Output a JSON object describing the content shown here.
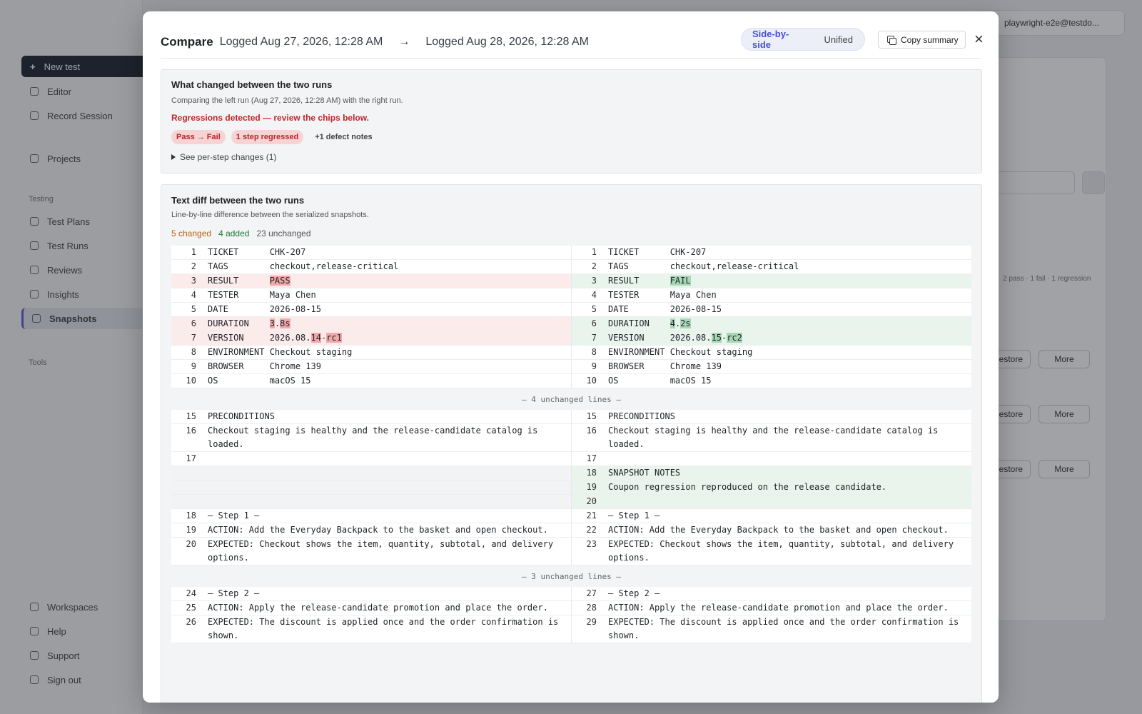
{
  "background": {
    "sidebar": {
      "primary": "New test",
      "items": [
        "Editor",
        "Record Session",
        "Projects"
      ],
      "section_testing": "Testing",
      "testing_items": [
        "Test Plans",
        "Test Runs",
        "Reviews",
        "Insights",
        "Snapshots"
      ],
      "section_tools": "Tools",
      "footer_items": [
        "Workspaces",
        "Help",
        "Support",
        "Sign out"
      ]
    },
    "account": "playwright-e2e@testdo...",
    "stats": "2 pass · 1 fail · 1 regression",
    "more_label": "More",
    "restore_label": "Restore"
  },
  "modal": {
    "title": "Compare",
    "left_run": "Logged Aug 27, 2026, 12:28 AM",
    "arrow": "→",
    "right_run": "Logged Aug 28, 2026, 12:28 AM",
    "view_options": [
      "Side-by-side",
      "Unified"
    ],
    "selected_view": "Side-by-side",
    "copy_label": "Copy summary",
    "close": "×"
  },
  "summary": {
    "title": "What changed between the two runs",
    "subtitle": "Comparing the left run (Aug 27, 2026, 12:28 AM) with the right run.",
    "warning": "Regressions detected — review the chips below.",
    "chips": [
      "Pass → Fail",
      "1 step regressed"
    ],
    "note": "+1 defect notes",
    "details": "See per-step changes (1)"
  },
  "diff": {
    "title": "Text diff between the two runs",
    "subtitle": "Line-by-line difference between the serialized snapshots.",
    "stats": {
      "changed": "5 changed",
      "added": "4 added",
      "unchanged": "23 unchanged"
    },
    "separator1": "— 4 unchanged lines —",
    "separator2": "— 3 unchanged lines —",
    "rows1": [
      {
        "l": {
          "n": "1",
          "t": "TICKET      CHK-207"
        },
        "r": {
          "n": "1",
          "t": "TICKET      CHK-207"
        }
      },
      {
        "l": {
          "n": "2",
          "t": "TAGS        checkout,release-critical"
        },
        "r": {
          "n": "2",
          "t": "TAGS        checkout,release-critical"
        }
      },
      {
        "type": "chg",
        "l": {
          "n": "3",
          "parts": [
            "RESULT      ",
            {
              "h": "PASS"
            }
          ]
        },
        "r": {
          "n": "3",
          "parts": [
            "RESULT      ",
            {
              "h": "FAIL"
            }
          ]
        }
      },
      {
        "l": {
          "n": "4",
          "t": "TESTER      Maya Chen"
        },
        "r": {
          "n": "4",
          "t": "TESTER      Maya Chen"
        }
      },
      {
        "l": {
          "n": "5",
          "t": "DATE        2026-08-15"
        },
        "r": {
          "n": "5",
          "t": "DATE        2026-08-15"
        }
      },
      {
        "type": "chg",
        "l": {
          "n": "6",
          "parts": [
            "DURATION    ",
            {
              "h": "3"
            },
            ".",
            {
              "h": "8s"
            }
          ]
        },
        "r": {
          "n": "6",
          "parts": [
            "DURATION    ",
            {
              "h": "4"
            },
            ".",
            {
              "h": "2s"
            }
          ]
        }
      },
      {
        "type": "chg",
        "l": {
          "n": "7",
          "parts": [
            "VERSION     2026.08.",
            {
              "h": "14"
            },
            "-",
            {
              "h": "rc1"
            }
          ]
        },
        "r": {
          "n": "7",
          "parts": [
            "VERSION     2026.08.",
            {
              "h": "15"
            },
            "-",
            {
              "h": "rc2"
            }
          ]
        }
      },
      {
        "l": {
          "n": "8",
          "t": "ENVIRONMENT Checkout staging"
        },
        "r": {
          "n": "8",
          "t": "ENVIRONMENT Checkout staging"
        }
      },
      {
        "l": {
          "n": "9",
          "t": "BROWSER     Chrome 139"
        },
        "r": {
          "n": "9",
          "t": "BROWSER     Chrome 139"
        }
      },
      {
        "l": {
          "n": "10",
          "t": "OS          macOS 15"
        },
        "r": {
          "n": "10",
          "t": "OS          macOS 15"
        }
      }
    ],
    "rows2": [
      {
        "l": {
          "n": "15",
          "t": "PRECONDITIONS"
        },
        "r": {
          "n": "15",
          "t": "PRECONDITIONS"
        }
      },
      {
        "wrap": true,
        "l": {
          "n": "16",
          "t": "Checkout staging is healthy and the release-candidate catalog is loaded."
        },
        "r": {
          "n": "16",
          "t": "Checkout staging is healthy and the release-candidate catalog is loaded."
        }
      },
      {
        "l": {
          "n": "17",
          "t": ""
        },
        "r": {
          "n": "17",
          "t": ""
        }
      },
      {
        "type": "add",
        "l": null,
        "r": {
          "n": "18",
          "t": "SNAPSHOT NOTES"
        }
      },
      {
        "type": "add",
        "l": null,
        "r": {
          "n": "19",
          "t": "Coupon regression reproduced on the release candidate."
        }
      },
      {
        "type": "add",
        "l": null,
        "r": {
          "n": "20",
          "t": ""
        }
      },
      {
        "l": {
          "n": "18",
          "t": "— Step 1 —"
        },
        "r": {
          "n": "21",
          "t": "— Step 1 —"
        }
      },
      {
        "l": {
          "n": "19",
          "t": "ACTION: Add the Everyday Backpack to the basket and open checkout."
        },
        "r": {
          "n": "22",
          "t": "ACTION: Add the Everyday Backpack to the basket and open checkout."
        }
      },
      {
        "wrap": true,
        "l": {
          "n": "20",
          "t": "EXPECTED: Checkout shows the item, quantity, subtotal, and delivery options."
        },
        "r": {
          "n": "23",
          "t": "EXPECTED: Checkout shows the item, quantity, subtotal, and delivery options."
        }
      }
    ],
    "rows3": [
      {
        "l": {
          "n": "24",
          "t": "— Step 2 —"
        },
        "r": {
          "n": "27",
          "t": "— Step 2 —"
        }
      },
      {
        "l": {
          "n": "25",
          "t": "ACTION: Apply the release-candidate promotion and place the order."
        },
        "r": {
          "n": "28",
          "t": "ACTION: Apply the release-candidate promotion and place the order."
        }
      },
      {
        "wrap": true,
        "l": {
          "n": "26",
          "t": "EXPECTED: The discount is applied once and the order confirmation is shown."
        },
        "r": {
          "n": "29",
          "t": "EXPECTED: The discount is applied once and the order confirmation is shown."
        }
      }
    ]
  },
  "colors": {
    "accent": "#4a4fd0",
    "danger": "#c0262b",
    "added": "#1e7a3a",
    "changed": "#b7620b"
  }
}
